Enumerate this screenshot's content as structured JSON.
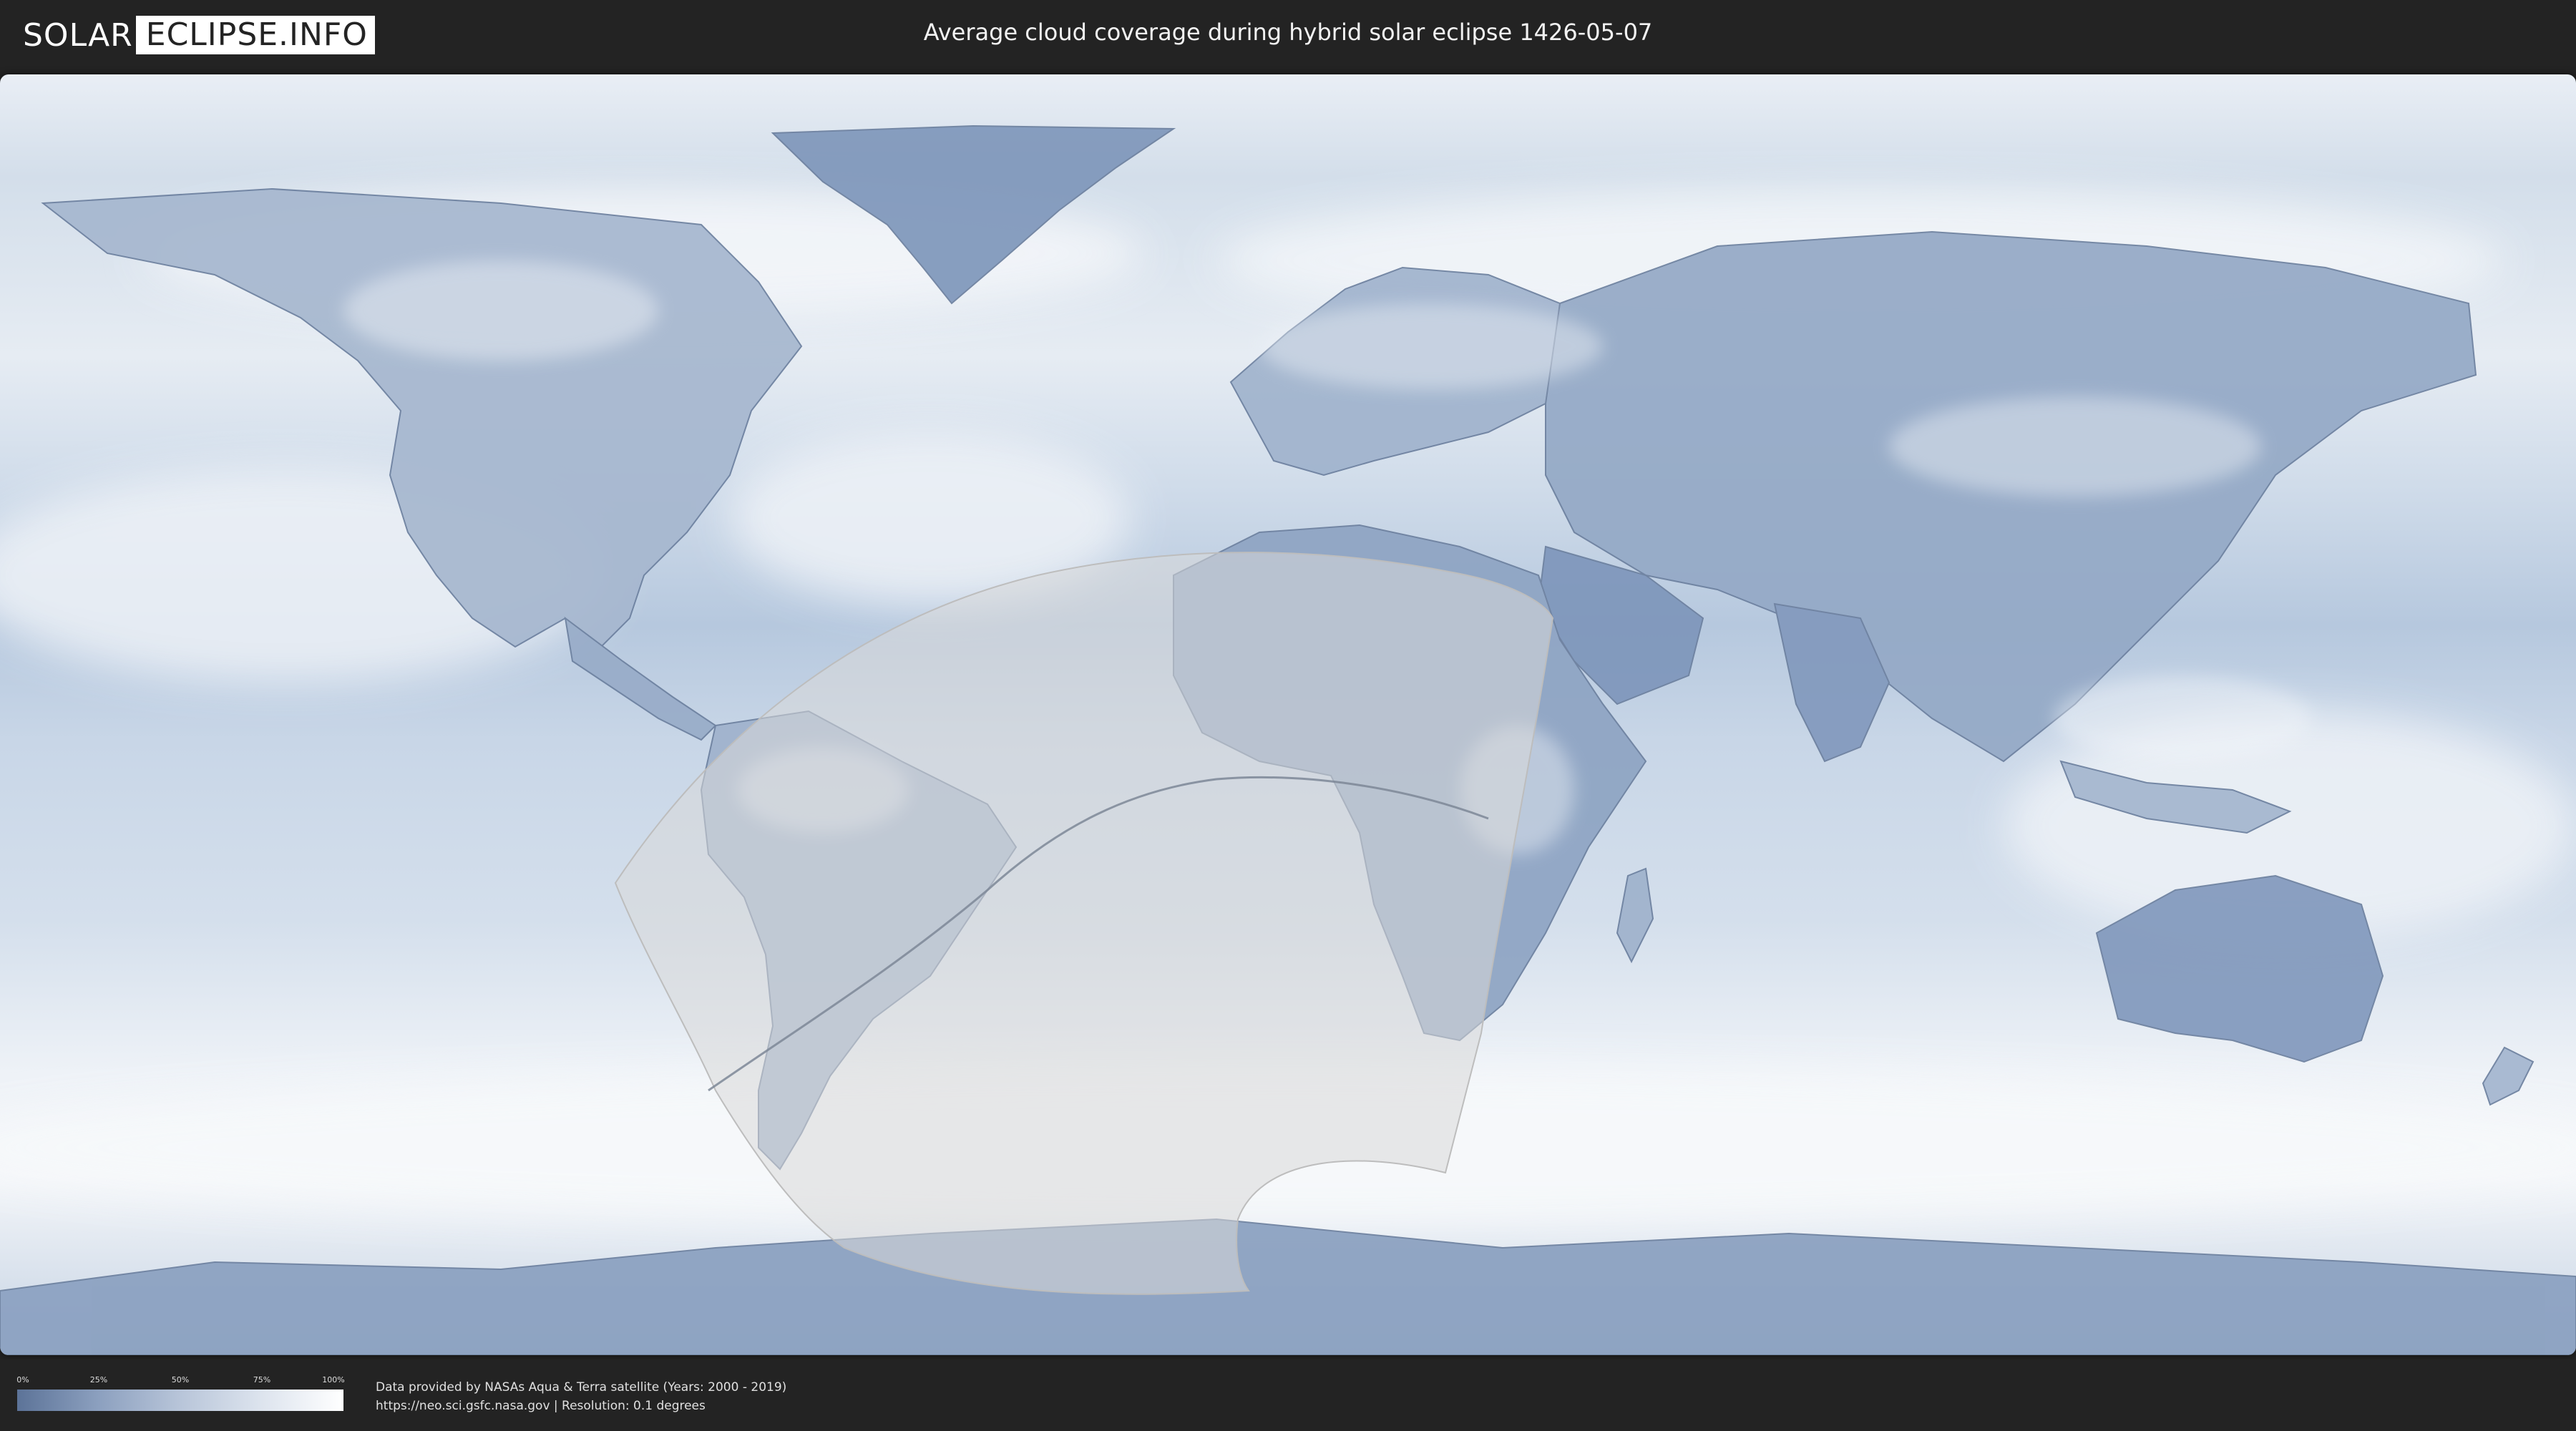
{
  "header": {
    "logo_left": "SOLAR",
    "logo_right": "ECLIPSE.INFO",
    "title": "Average cloud coverage during hybrid solar eclipse 1426-05-07"
  },
  "map": {
    "ocean_color": "#c9d6e6",
    "land_color": "#8fa5c4",
    "cloud_color": "#f2f5f9",
    "eclipse_overlay_color": "#d8d8d8"
  },
  "legend": {
    "ticks": [
      "0%",
      "25%",
      "50%",
      "75%",
      "100%"
    ],
    "gradient_start": "#5c7398",
    "gradient_end": "#ffffff"
  },
  "footer": {
    "credit_line1": "Data provided by NASAs Aqua & Terra satellite (Years: 2000 - 2019)",
    "credit_line2": "https://neo.sci.gsfc.nasa.gov | Resolution: 0.1 degrees"
  }
}
